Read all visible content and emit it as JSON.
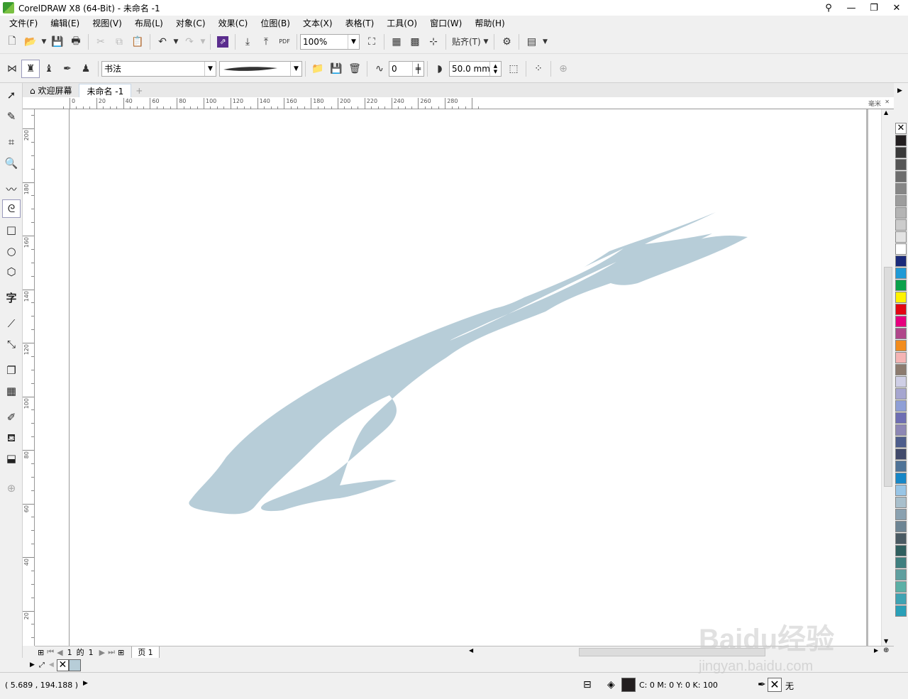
{
  "window": {
    "title": "CorelDRAW X8 (64-Bit) - 未命名 -1"
  },
  "menu": [
    "文件(F)",
    "编辑(E)",
    "视图(V)",
    "布局(L)",
    "对象(C)",
    "效果(C)",
    "位图(B)",
    "文本(X)",
    "表格(T)",
    "工具(O)",
    "窗口(W)",
    "帮助(H)"
  ],
  "toolbar": {
    "zoom": "100%",
    "snap_label": "贴齐(T)",
    "pdf_label": "PDF"
  },
  "property_bar": {
    "style_preset": "书法",
    "smoothing": "0",
    "width": "50.0 mm"
  },
  "doc_tabs": {
    "welcome": "欢迎屏幕",
    "document": "未命名 -1",
    "add": "+"
  },
  "rulers": {
    "unit": "毫米",
    "h_labels": [
      "0",
      "20",
      "40",
      "60",
      "80",
      "100",
      "120",
      "140",
      "160",
      "180",
      "200",
      "220",
      "240",
      "260",
      "280"
    ],
    "v_labels": [
      "200",
      "180",
      "160",
      "140",
      "120",
      "100",
      "80",
      "60",
      "40",
      "20"
    ]
  },
  "page_nav": {
    "current": "1",
    "of_label": "的",
    "total": "1",
    "page_tab": "页 1"
  },
  "status": {
    "coords": "( 5.689 , 194.188 )",
    "fill_color": "C: 0 M: 0 Y: 0 K: 100",
    "outline": "无"
  },
  "colors": {
    "stroke_fill": "#b7cdd8"
  },
  "palette_colors": [
    "#231f20",
    "#3a3a3a",
    "#555555",
    "#6d6d6d",
    "#868686",
    "#9d9d9d",
    "#b4b4b4",
    "#cccccc",
    "#e3e3e3",
    "#ffffff",
    "#1a2a7a",
    "#1f9ad6",
    "#0aa14a",
    "#fff200",
    "#e30613",
    "#e6007e",
    "#b0478a",
    "#f28c1d",
    "#f4b4b4",
    "#8c7b6f",
    "#cfcfe6",
    "#a6a6d0",
    "#8f9fd6",
    "#6e6eb3",
    "#8d87b5",
    "#4d5d8c",
    "#414a6b",
    "#4f7397",
    "#1787c7",
    "#98c5e6",
    "#a8bfcc",
    "#8aa1b0",
    "#6d8594",
    "#4a5a63",
    "#2f5f5f",
    "#3f7f7f",
    "#5f9f9f",
    "#5bb0a6",
    "#3fa3b3",
    "#2aa0b8"
  ],
  "watermark": {
    "brand": "Baidu经验",
    "url": "jingyan.baidu.com"
  }
}
